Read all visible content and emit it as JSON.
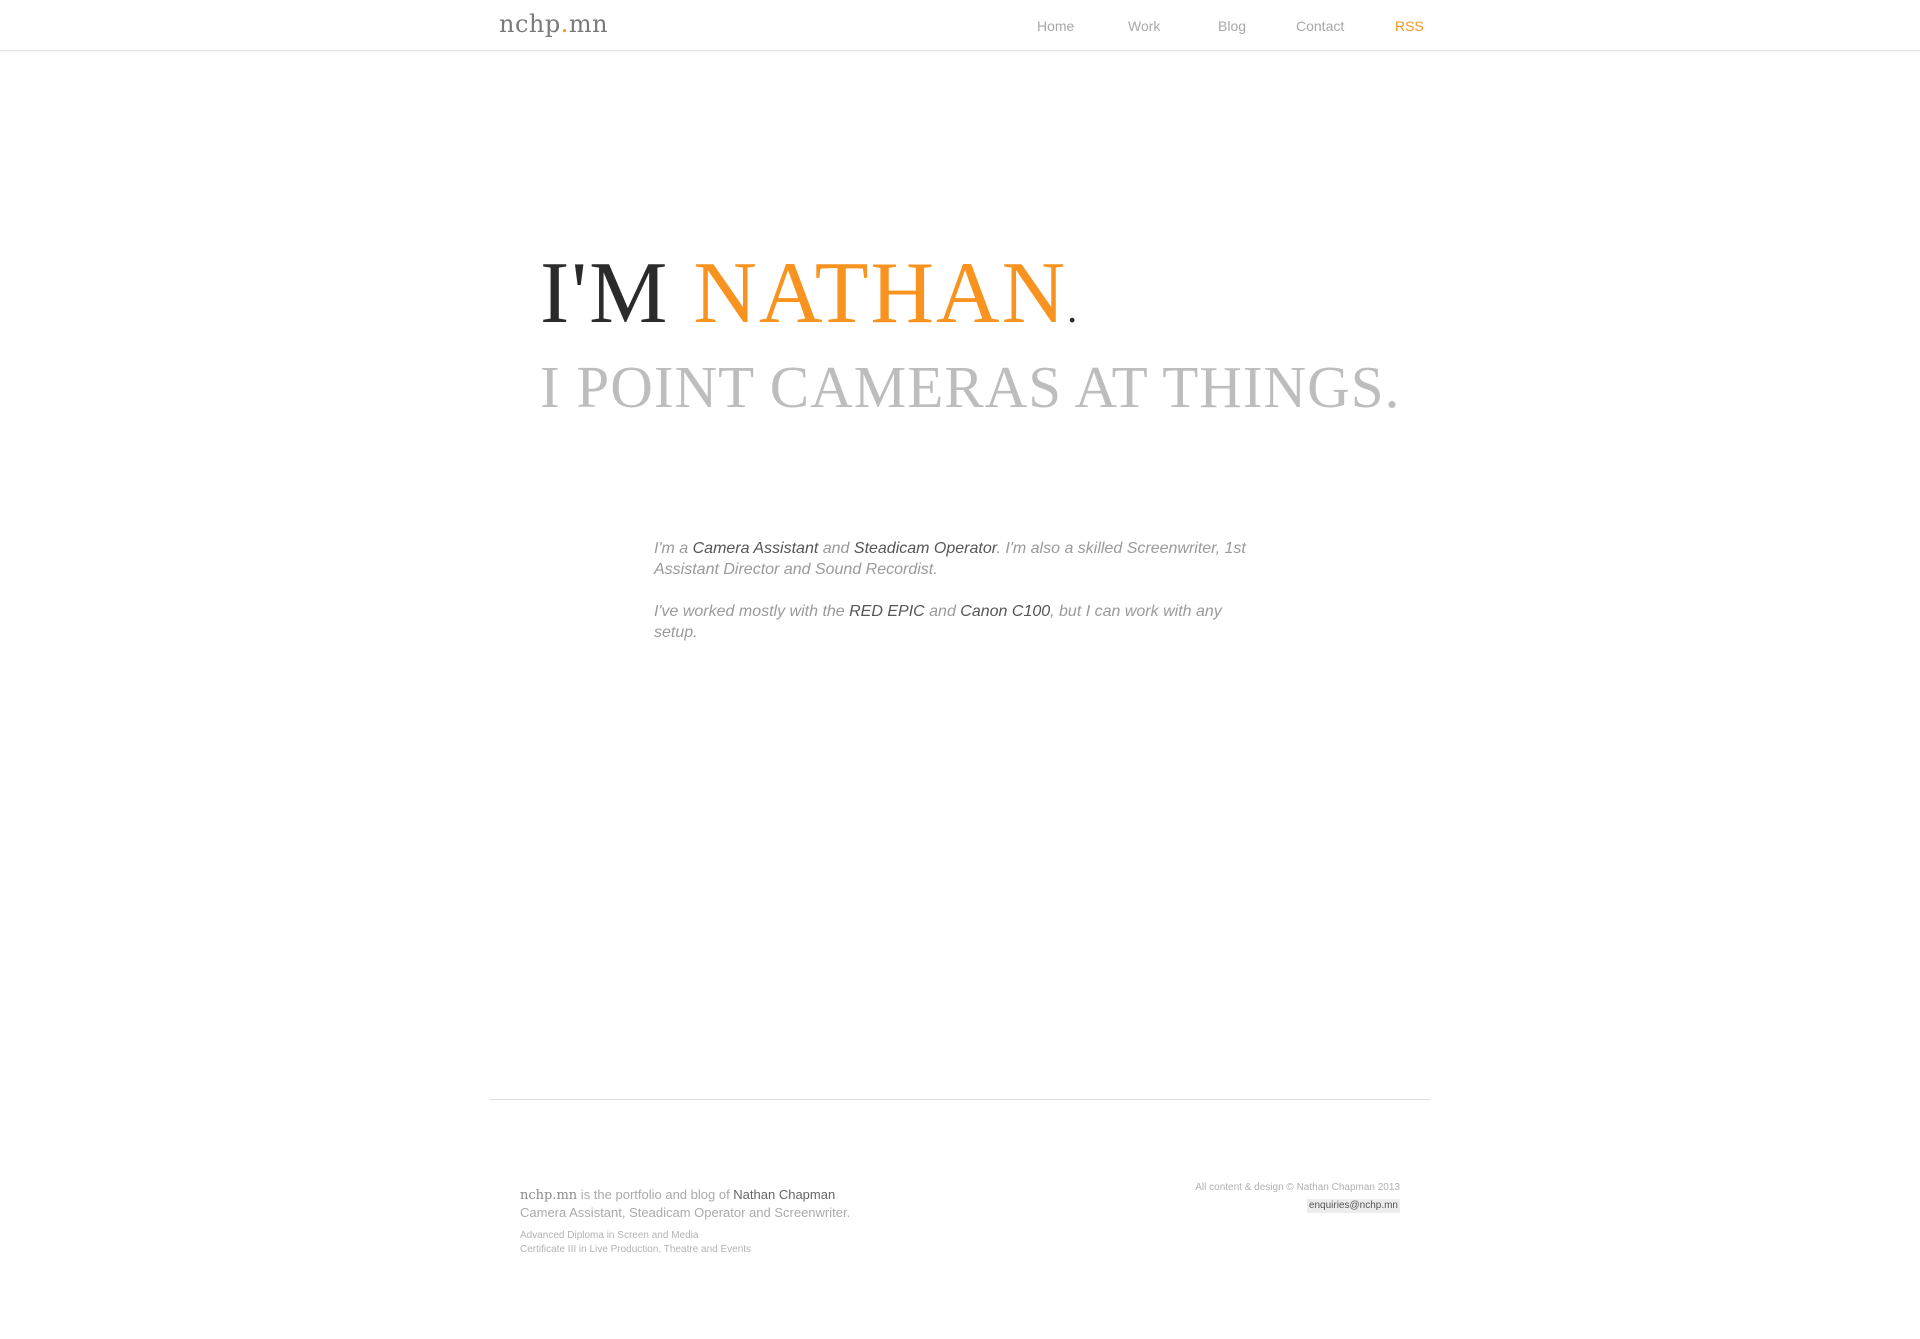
{
  "header": {
    "logo": {
      "pre": "nchp",
      "dot": ".",
      "post": "mn"
    },
    "nav": [
      {
        "label": "Home"
      },
      {
        "label": "Work"
      },
      {
        "label": "Blog"
      },
      {
        "label": "Contact"
      },
      {
        "label": "RSS"
      }
    ]
  },
  "hero": {
    "im": "I'M",
    "name": "NATHAN",
    "period": ".",
    "tagline": "I POINT CAMERAS AT THINGS."
  },
  "intro": {
    "p1": {
      "a": "I'm a ",
      "role1": "Camera Assistant",
      "b": " and ",
      "role2": "Steadicam Operator",
      "c": ". I'm also a skilled Screenwriter, 1st Assistant Director and Sound Recordist."
    },
    "p2": {
      "a": "I've worked mostly with the ",
      "cam1": "RED EPIC",
      "b": " and ",
      "cam2": "Canon C100",
      "c": ", but I can work with any setup."
    }
  },
  "footer": {
    "brand": "nchp.mn",
    "text1": " is the portfolio and blog of ",
    "owner": "Nathan Chapman",
    "roles": "Camera Assistant, Steadicam Operator and Screenwriter.",
    "qual1": "Advanced Diploma in Screen and Media",
    "qual2": "Certificate III in Live Production, Theatre and Events",
    "copyright": "All content & design © Nathan Chapman 2013",
    "email": "enquiries@nchp.mn"
  },
  "colors": {
    "accent": "#f7931e",
    "text_dark": "#2b2b2b",
    "text_muted": "#9a9a9a"
  }
}
